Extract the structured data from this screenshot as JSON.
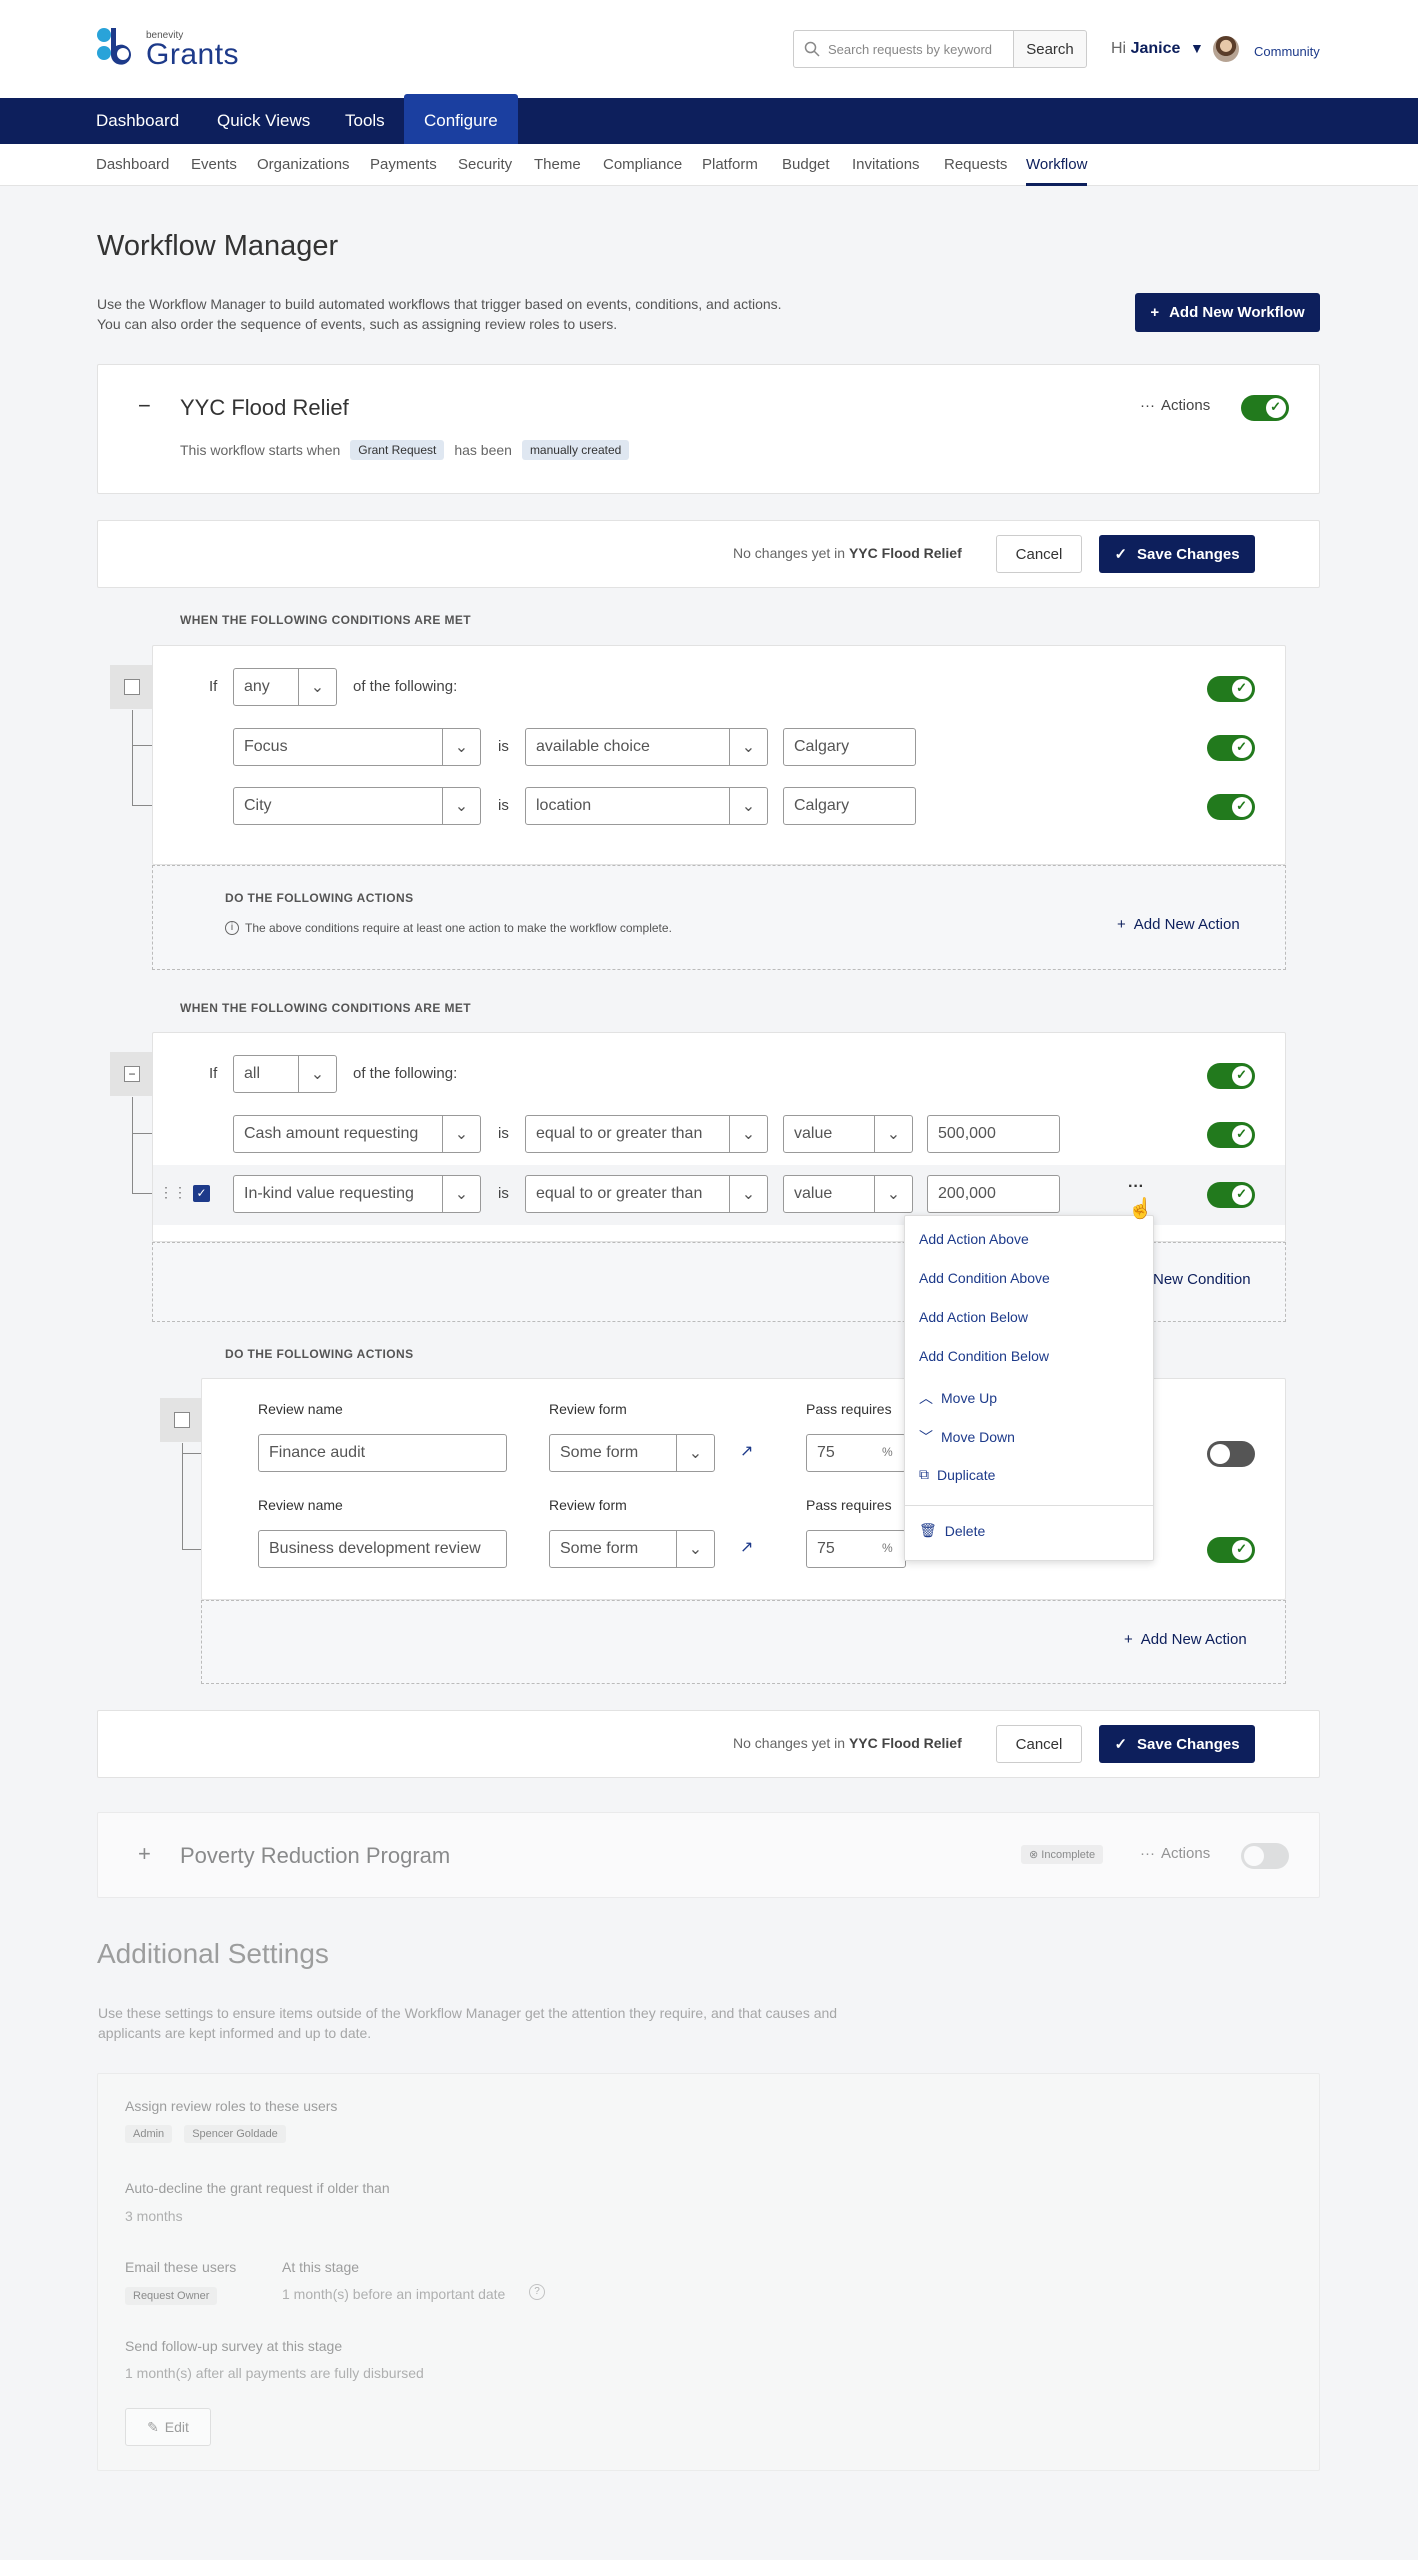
{
  "header": {
    "logo_small": "benevity",
    "logo_text": "Grants",
    "search_placeholder": "Search requests by keyword",
    "search_button": "Search",
    "greeting": "Hi",
    "user": "Janice",
    "community": "Community"
  },
  "nav": [
    "Dashboard",
    "Quick Views",
    "Tools",
    "Configure"
  ],
  "subnav": [
    "Dashboard",
    "Events",
    "Organizations",
    "Payments",
    "Security",
    "Theme",
    "Compliance",
    "Platform",
    "Budget",
    "Invitations",
    "Requests",
    "Workflow"
  ],
  "page": {
    "title": "Workflow Manager",
    "desc1": "Use the Workflow Manager to build automated workflows that trigger based on events, conditions, and actions.",
    "desc2": "You can also order the sequence of events, such as assigning review roles to users.",
    "add_workflow": "Add New Workflow"
  },
  "workflow1": {
    "title": "YYC Flood Relief",
    "starts_text": "This workflow starts when",
    "tag1": "Grant Request",
    "mid": "has been",
    "tag2": "manually created",
    "actions": "Actions"
  },
  "savebar": {
    "no_changes": "No changes yet in",
    "name": "YYC Flood Relief",
    "cancel": "Cancel",
    "save": "Save Changes"
  },
  "conds_label": "WHEN THE FOLLOWING CONDITIONS ARE MET",
  "actions_label": "DO THE FOLLOWING ACTIONS",
  "group1": {
    "if": "If",
    "mode": "any",
    "of": "of the following:",
    "rows": [
      {
        "field": "Focus",
        "is": "is",
        "op": "available choice",
        "value": "Calgary"
      },
      {
        "field": "City",
        "is": "is",
        "op": "location",
        "value": "Calgary"
      }
    ],
    "note": "The above conditions require at least one action to make the workflow complete.",
    "add_action": "Add New Action"
  },
  "group2": {
    "if": "If",
    "mode": "all",
    "of": "of the following:",
    "rows": [
      {
        "field": "Cash amount requesting",
        "is": "is",
        "op": "equal to or greater than",
        "type": "value",
        "value": "500,000"
      },
      {
        "field": "In-kind value requesting",
        "is": "is",
        "op": "equal to or greater than",
        "type": "value",
        "value": "200,000"
      }
    ],
    "add_condition": "New Condition",
    "add_action": "Add New Action"
  },
  "reviews": {
    "name_label": "Review name",
    "form_label": "Review form",
    "pass_label": "Pass requires",
    "pct": "%",
    "rows": [
      {
        "name": "Finance audit",
        "form": "Some form",
        "pass": "75"
      },
      {
        "name": "Business development review",
        "form": "Some form",
        "pass": "75"
      }
    ]
  },
  "menu": [
    "Add Action Above",
    "Add Condition Above",
    "Add Action Below",
    "Add Condition Below",
    "Move Up",
    "Move Down",
    "Duplicate",
    "Delete"
  ],
  "workflow2": {
    "title": "Poverty Reduction Program",
    "badge": "Incomplete",
    "actions": "Actions"
  },
  "additional": {
    "title": "Additional Settings",
    "desc1": "Use these settings to ensure items outside of the Workflow Manager get the attention they require, and that causes and",
    "desc2": "applicants are kept informed and up to date.",
    "assign_label": "Assign review roles to these users",
    "assign_tags": [
      "Admin",
      "Spencer Goldade"
    ],
    "decline_label": "Auto-decline the grant request if older than",
    "decline_value": "3 months",
    "email_label": "Email these users",
    "email_tag": "Request Owner",
    "stage_label": "At this stage",
    "stage_value": "1 month(s) before an important date",
    "survey_label": "Send follow-up survey at this stage",
    "survey_value": "1 month(s) after all payments are fully disbursed",
    "edit": "Edit"
  }
}
